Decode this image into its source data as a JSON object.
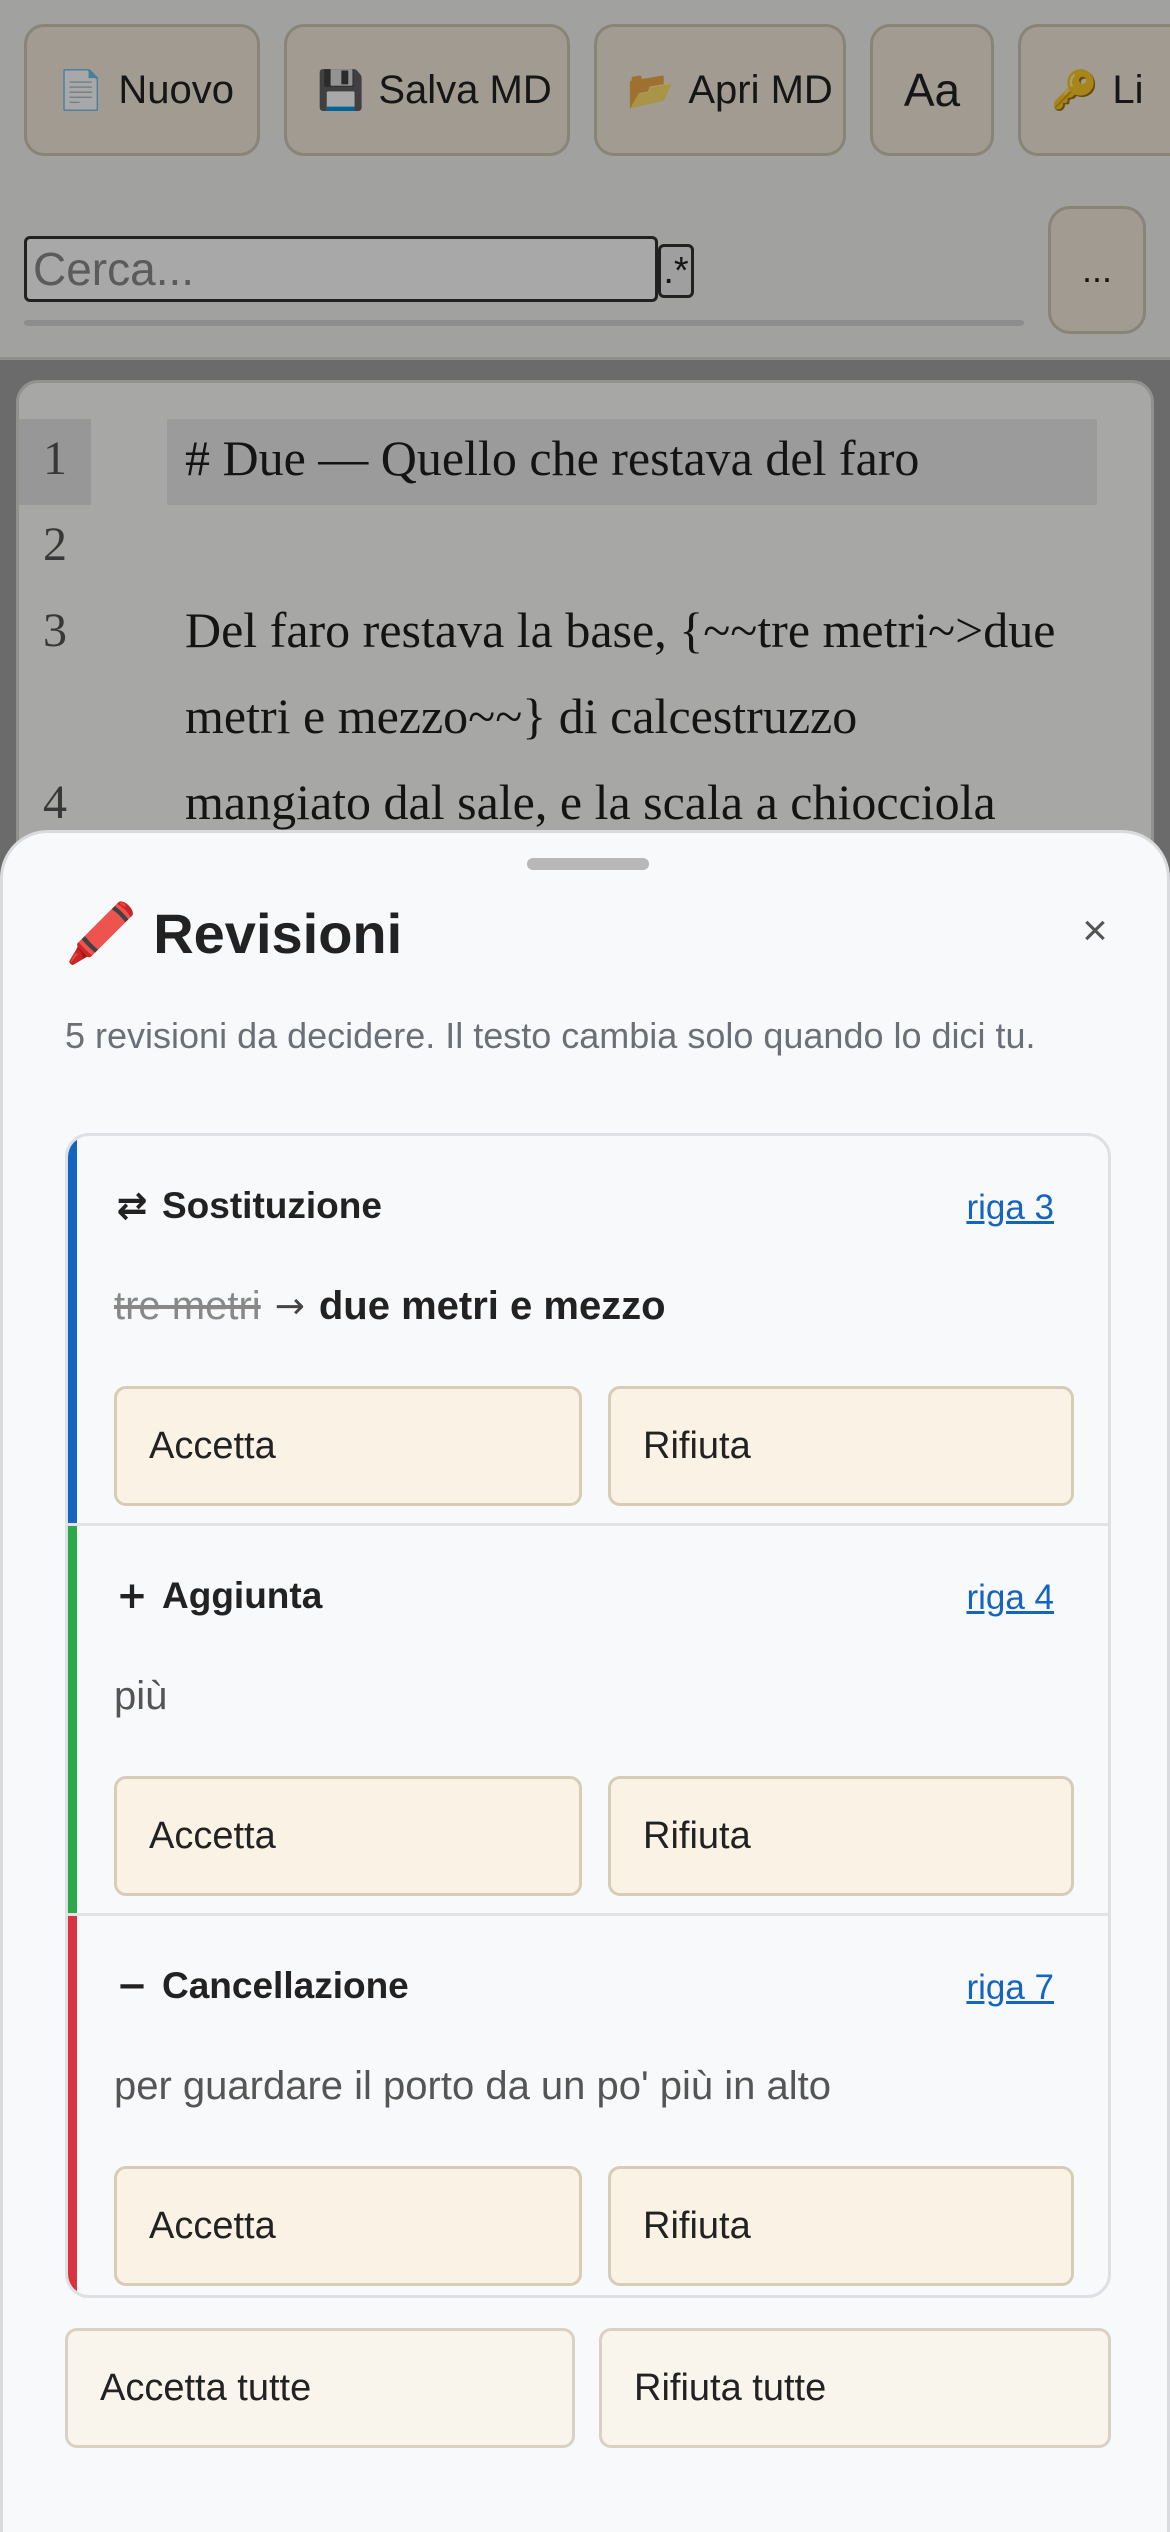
{
  "toolbar": {
    "new": {
      "icon": "📄",
      "label": "Nuovo"
    },
    "save": {
      "icon": "💾",
      "label": "Salva MD"
    },
    "open": {
      "icon": "📂",
      "label": "Apri MD"
    },
    "font": {
      "label": "Aa"
    },
    "key": {
      "icon": "🔑",
      "label": "Li"
    }
  },
  "search": {
    "placeholder": "Cerca...",
    "regex_label": ".*",
    "more_label": "..."
  },
  "editor": {
    "lines": [
      {
        "num": "1",
        "text": "# Due — Quello che restava del faro"
      },
      {
        "num": "2",
        "text": ""
      },
      {
        "num": "3",
        "text": "Del faro restava la base, {~~tre metri~>due"
      },
      {
        "num": "",
        "text": "metri e mezzo~~} di calcestruzzo"
      },
      {
        "num": "4",
        "text": "mangiato dal sale, e la scala a chiocciola"
      }
    ]
  },
  "sheet": {
    "title_icon": "🖍️",
    "title": "Revisioni",
    "close": "×",
    "subtitle": "5 revisioni da decidere. Il testo cambia solo quando lo dici tu.",
    "cards": [
      {
        "type_icon": "⇄",
        "type": "Sostituzione",
        "link": "riga 3",
        "old": "tre metri",
        "arrow": "→",
        "new": "due metri e mezzo",
        "accept": "Accetta",
        "reject": "Rifiuta",
        "color": "#1565c0"
      },
      {
        "type_icon": "+",
        "type": "Aggiunta",
        "link": "riga 4",
        "text": "più",
        "accept": "Accetta",
        "reject": "Rifiuta",
        "color": "#2ea84a"
      },
      {
        "type_icon": "−",
        "type": "Cancellazione",
        "link": "riga 7",
        "text": "per guardare il porto da un po' più in alto",
        "accept": "Accetta",
        "reject": "Rifiuta",
        "color": "#d8343f"
      }
    ],
    "accept_all": "Accetta tutte",
    "reject_all": "Rifiuta tutte"
  }
}
